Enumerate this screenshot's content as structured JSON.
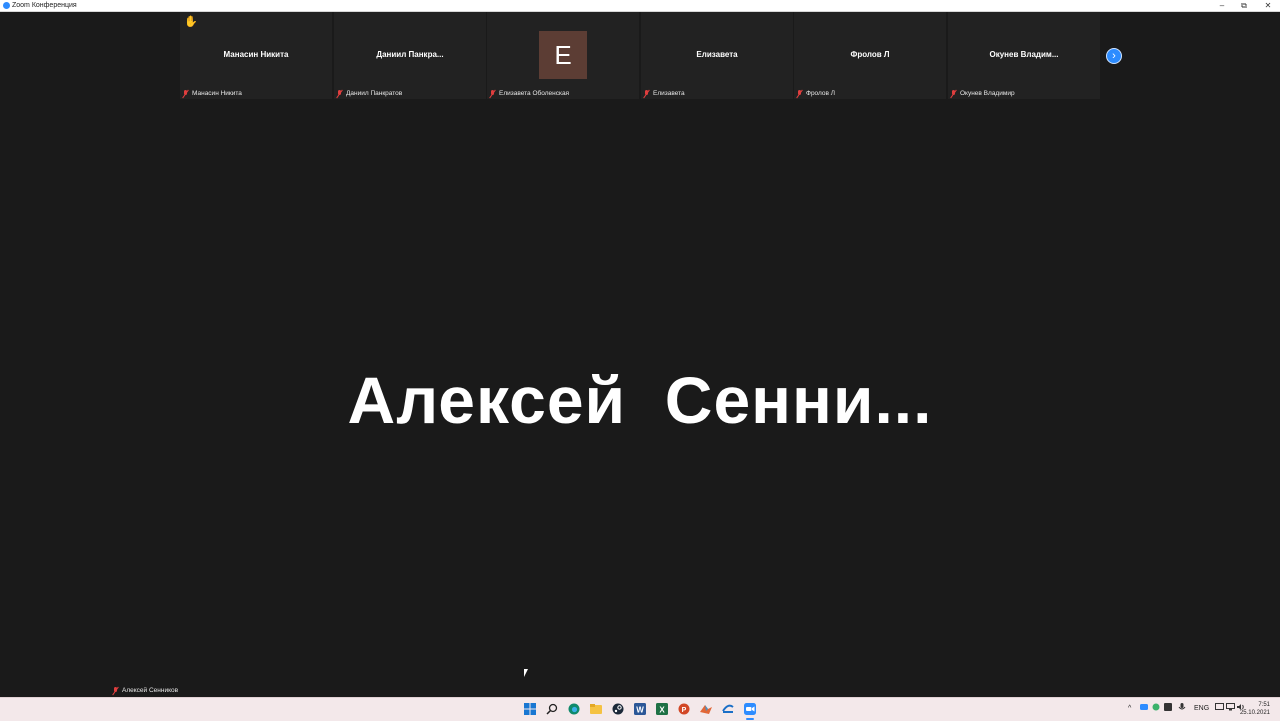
{
  "window": {
    "title": "Zoom Конференция",
    "minimize": "–",
    "restore": "⧉",
    "close": "✕"
  },
  "gallery": {
    "tiles": [
      {
        "display": "Манасин Никита",
        "footer": "Манасин Никита"
      },
      {
        "display": "Даниил  Панкра...",
        "footer": "Даниил Панкратов"
      },
      {
        "display": "",
        "avatar_letter": "E",
        "footer": "Елизавета Оболенская"
      },
      {
        "display": "Елизавета",
        "footer": "Елизавета"
      },
      {
        "display": "Фролов Л",
        "footer": "Фролов Л"
      },
      {
        "display": "Окунев  Владим...",
        "footer": "Окунев Владимир"
      }
    ],
    "raise_hand_icon": "✋",
    "next_page_icon": "›"
  },
  "speaker": {
    "name": "Алексей  Сенни...",
    "self_label": "Алексей Сенников"
  },
  "taskbar": {
    "icons": [
      "windows-start-icon",
      "search-icon",
      "edge-icon",
      "file-explorer-icon",
      "steam-icon",
      "word-icon",
      "excel-icon",
      "powerpoint-icon",
      "matlab-icon",
      "remote-icon",
      "zoom-icon"
    ],
    "language": "ENG",
    "time": "7:51",
    "date": "25.10.2021"
  },
  "colors": {
    "background": "#1a1a1a",
    "tile": "#222222",
    "accent": "#2d8cff",
    "muted": "#e03e3e",
    "avatar": "#5c3d34"
  }
}
